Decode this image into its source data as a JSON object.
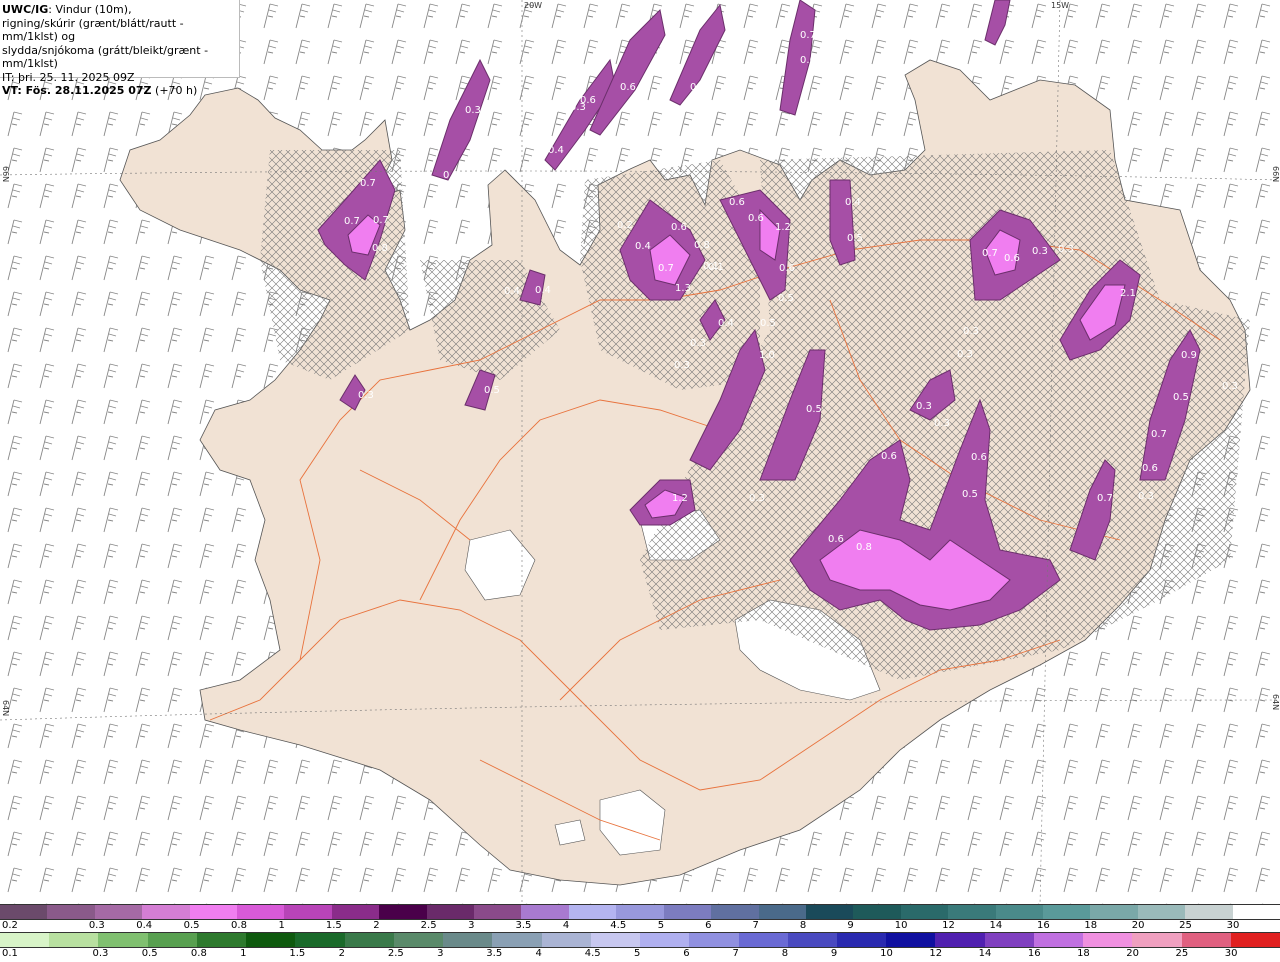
{
  "header": {
    "model_label": "UWC/IG",
    "line1_rest": ": Vindur (10m),",
    "line2": "rigning/skúrir (grænt/blátt/rautt - mm/1klst) og",
    "line3": "slydda/snjókoma (grátt/bleikt/grænt - mm/1klst)",
    "it_line": "IT: þri. 25. 11. 2025 09Z",
    "vt_line": "VT: Fös. 28.11.2025 07Z",
    "vt_lead": " (+70 h)"
  },
  "grid_labels": {
    "lon_20w": "20W",
    "lon_15w": "15W",
    "lat_66n_left": "66N",
    "lat_66n_right": "66N",
    "lat_64n_left": "64N",
    "lat_64n_right": "64N"
  },
  "precip_values": [
    "0.7",
    "0.3",
    "0.7",
    "0.6",
    "0.6",
    "0.7",
    "0.6",
    "0.3",
    "0.3",
    "0.4",
    "0.3",
    "0.7",
    "0.8",
    "0.4",
    "0.2",
    "0.6",
    "0.4",
    "0.7",
    "1.3",
    "0.8",
    "0.1",
    "0.6",
    "0.6",
    "1.2",
    "0.6",
    "0.5",
    "0.4",
    "0.5",
    "0.7",
    "0.6",
    "0.3",
    "0.3",
    "2.1",
    "0.9",
    "0.5",
    "0.3",
    "0.3",
    "0.3",
    "0.4",
    "1.0",
    "0.5",
    "0.4",
    "0.5",
    "0.3",
    "1.2",
    "0.3",
    "0.3",
    "0.6",
    "0.6",
    "0.5",
    "0.7",
    "0.6",
    "0.3",
    "0.7",
    "0.3",
    "0.1",
    "0.5",
    "0.8",
    "0.6",
    "0.3",
    "0.3"
  ],
  "legend": {
    "snow_scale": {
      "labels": [
        "0.2",
        "0.3",
        "0.4",
        "0.5",
        "0.8",
        "1",
        "1.5",
        "2",
        "2.5",
        "3",
        "3.5",
        "4",
        "4.5",
        "5",
        "6",
        "7",
        "8",
        "9",
        "10",
        "12",
        "14",
        "16",
        "18",
        "20",
        "25",
        "30"
      ],
      "colors": [
        "#6b4a6b",
        "#8a5a8a",
        "#a56aa5",
        "#d47ed4",
        "#f07ef0",
        "#d85ad8",
        "#b844b8",
        "#8a2c8a",
        "#4a004a",
        "#6a2a6a",
        "#8a4a8a",
        "#a87ad0",
        "#b4b4f0",
        "#9898dc",
        "#7c7cc0",
        "#6070a0",
        "#4a6a8a",
        "#1a4a5a",
        "#1e5a5a",
        "#2a6a6a",
        "#3a7a7a",
        "#4a8a8a",
        "#5a9a9a",
        "#7aa8a8",
        "#9ababa",
        "#c8d2d2",
        "#ffffff"
      ]
    },
    "rain_scale": {
      "labels": [
        "0.1",
        "0.3",
        "0.5",
        "0.8",
        "1",
        "1.5",
        "2",
        "2.5",
        "3",
        "3.5",
        "4",
        "4.5",
        "5",
        "6",
        "7",
        "8",
        "9",
        "10",
        "12",
        "14",
        "16",
        "18",
        "20",
        "25",
        "30"
      ],
      "colors": [
        "#d8f4c8",
        "#b8e0a0",
        "#80c070",
        "#58a050",
        "#2e7a2e",
        "#0e5a0e",
        "#1a6a2a",
        "#3a7a4a",
        "#5a8a6a",
        "#6a8a8a",
        "#8aa0b4",
        "#aab4d4",
        "#c8c8f0",
        "#b0b0f0",
        "#9090e0",
        "#6a6ad4",
        "#4a4ac0",
        "#2a2ab0",
        "#1010a0",
        "#5020b0",
        "#8040c0",
        "#c070e0",
        "#f090e0",
        "#f0a0c0",
        "#e06080",
        "#e02020"
      ]
    }
  }
}
